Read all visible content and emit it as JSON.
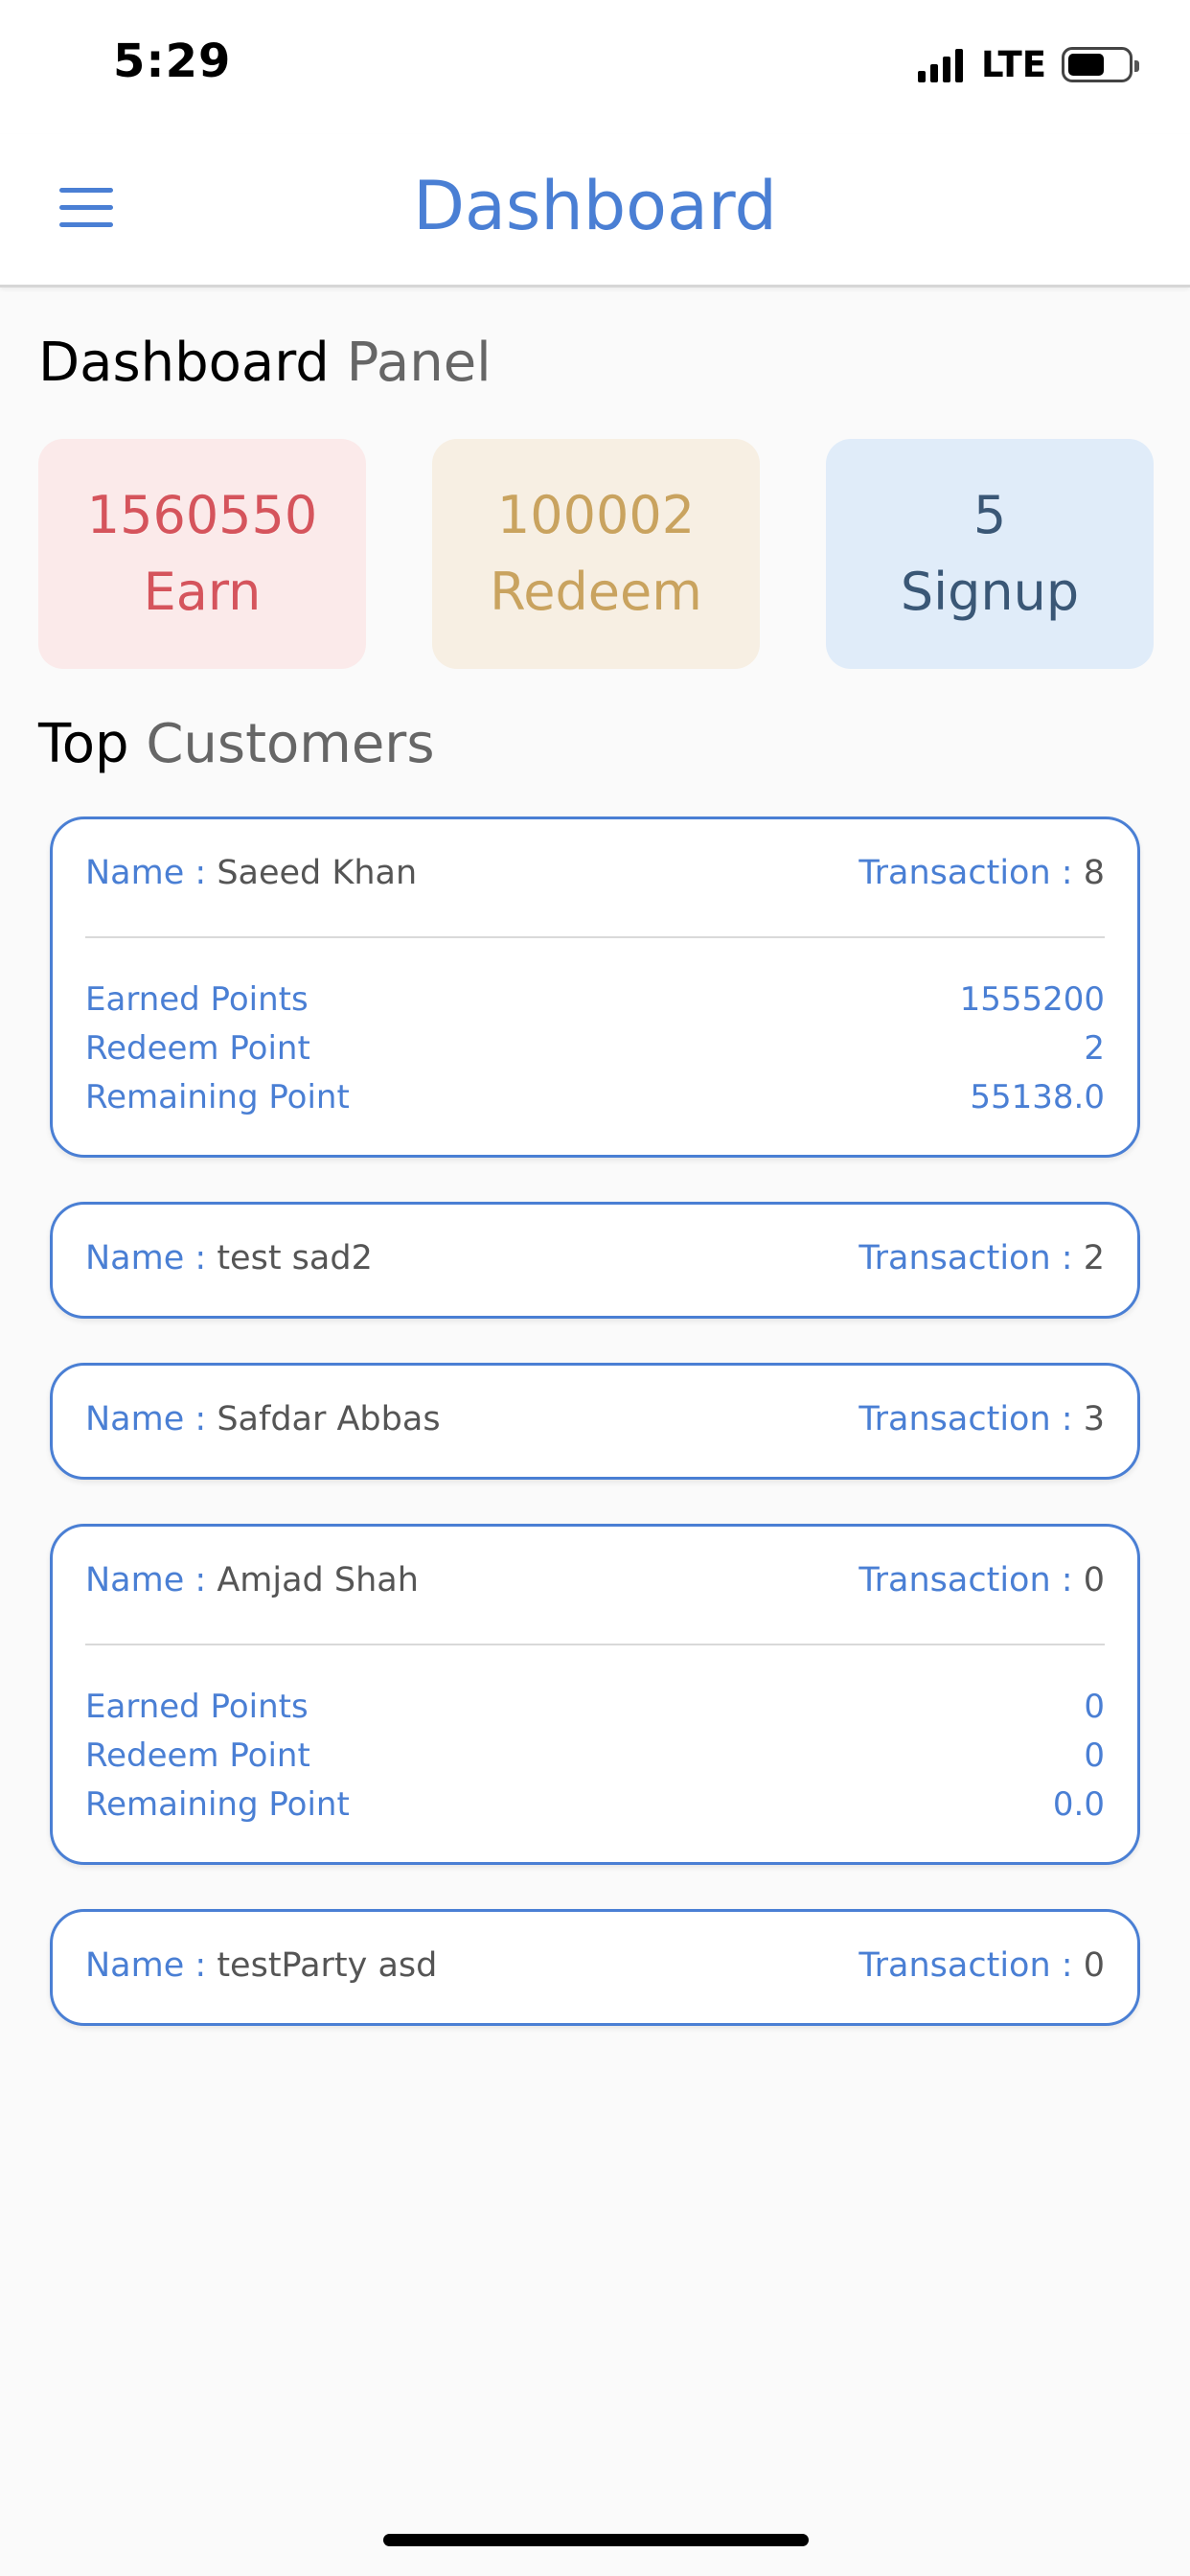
{
  "status_bar": {
    "time": "5:29",
    "network": "LTE",
    "battery_level": 0.62
  },
  "nav": {
    "title": "Dashboard",
    "menu_icon": "hamburger-menu-icon"
  },
  "panel_heading": {
    "strong": "Dashboard",
    "light": "Panel"
  },
  "stats": {
    "earn": {
      "value": "1560550",
      "label": "Earn",
      "color": "#d5545c",
      "bg": "#fbeaea"
    },
    "redeem": {
      "value": "100002",
      "label": "Redeem",
      "color": "#c9a35f",
      "bg": "#f7efe3"
    },
    "signup": {
      "value": "5",
      "label": "Signup",
      "color": "#3a5776",
      "bg": "#e0ecf9"
    }
  },
  "customers_heading": {
    "strong": "Top",
    "light": "Customers"
  },
  "customer_labels": {
    "name": "Name :",
    "transaction": "Transaction :",
    "earned": "Earned Points",
    "redeem": "Redeem Point",
    "remaining": "Remaining Point"
  },
  "customers": [
    {
      "name": "Saeed Khan",
      "transactions": "8",
      "earned": "1555200",
      "redeem": "2",
      "remaining": "55138.0"
    },
    {
      "name": "test sad2",
      "transactions": "2"
    },
    {
      "name": "Safdar Abbas",
      "transactions": "3"
    },
    {
      "name": "Amjad Shah",
      "transactions": "0",
      "earned": "0",
      "redeem": "0",
      "remaining": "0.0"
    },
    {
      "name": "testParty asd",
      "transactions": "0"
    }
  ],
  "colors": {
    "accent": "#4a7fd4",
    "text_muted": "#555555"
  }
}
